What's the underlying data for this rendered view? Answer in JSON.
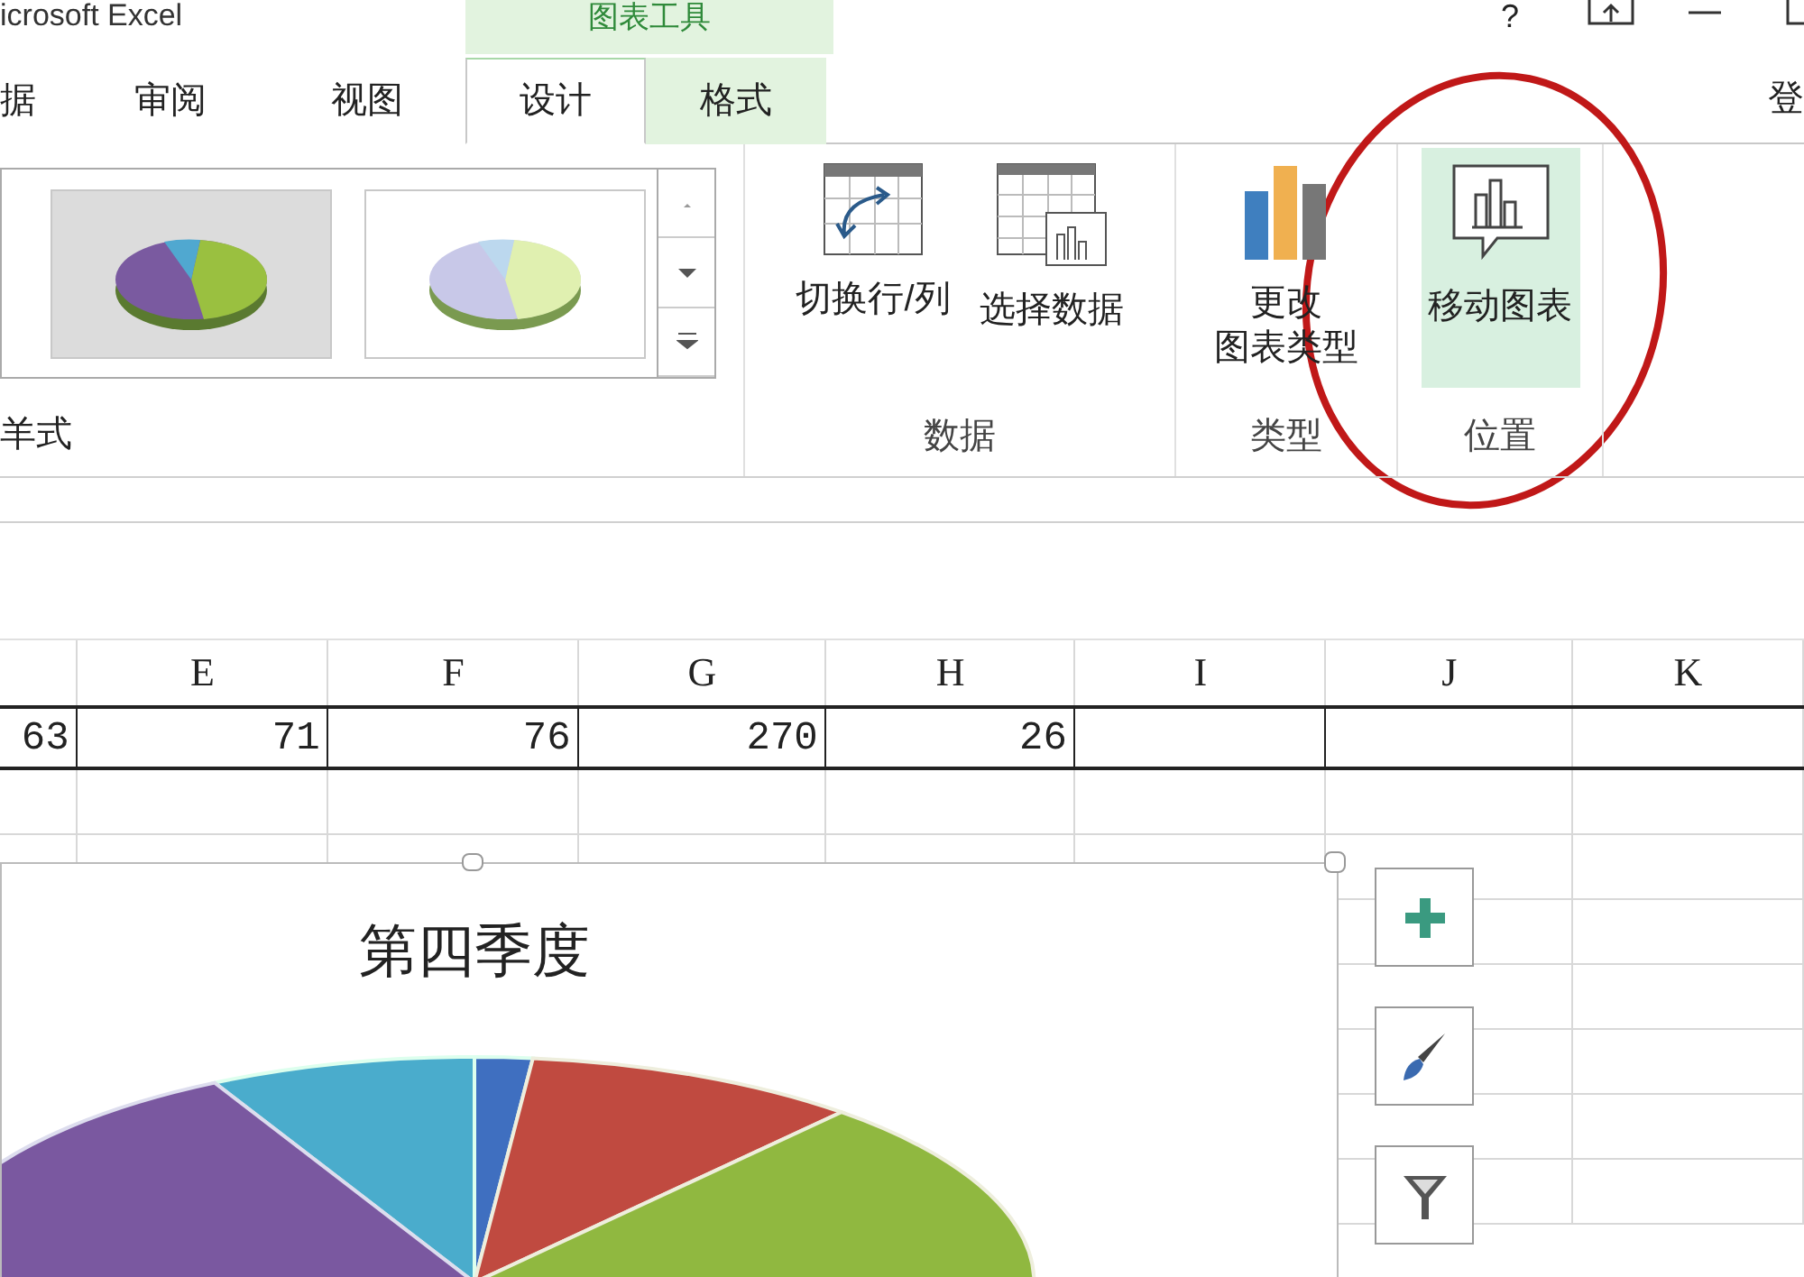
{
  "window": {
    "title": "icrosoft Excel",
    "tool_context": "图表工具",
    "help": "?",
    "account": "登"
  },
  "tabs": [
    {
      "label": "据",
      "selected": false,
      "context": false
    },
    {
      "label": "审阅",
      "selected": false,
      "context": false
    },
    {
      "label": "视图",
      "selected": false,
      "context": false
    },
    {
      "label": "设计",
      "selected": true,
      "context": true
    },
    {
      "label": "格式",
      "selected": false,
      "context": true
    }
  ],
  "ribbon": {
    "style_group": {
      "label": "羊式"
    },
    "groups": [
      {
        "label": "数据",
        "buttons": [
          {
            "lines": [
              "切换行/列"
            ],
            "kind": "switch",
            "selected": false
          },
          {
            "lines": [
              "选择数据"
            ],
            "kind": "select",
            "selected": false
          }
        ]
      },
      {
        "label": "类型",
        "buttons": [
          {
            "lines": [
              "更改",
              "图表类型"
            ],
            "kind": "type",
            "selected": false
          }
        ]
      },
      {
        "label": "位置",
        "buttons": [
          {
            "lines": [
              "移动图表"
            ],
            "kind": "move",
            "selected": true
          }
        ]
      }
    ]
  },
  "sheet": {
    "columns": [
      "E",
      "F",
      "G",
      "H",
      "I",
      "J",
      "K"
    ],
    "row_cells": [
      "63",
      "71",
      "76",
      "270",
      "26"
    ]
  },
  "chart": {
    "title": "第四季度",
    "side_buttons": [
      {
        "kind": "add"
      },
      {
        "kind": "style"
      },
      {
        "kind": "filter"
      }
    ]
  }
}
